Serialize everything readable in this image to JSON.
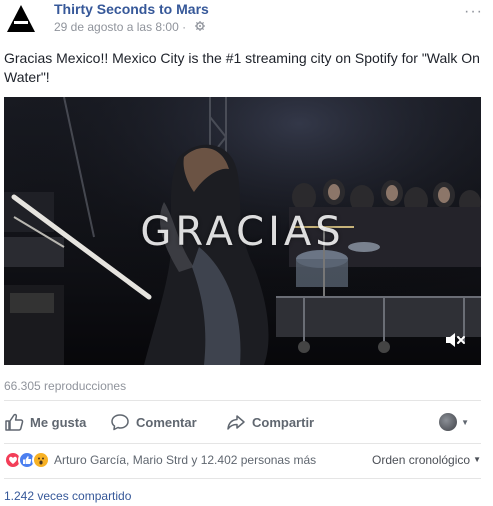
{
  "post": {
    "page_name": "Thirty Seconds to Mars",
    "timestamp": "29 de agosto a las 8:00",
    "separator": "·",
    "privacy_icon": "gear-globe-icon",
    "options_icon": "ellipsis-icon",
    "options_label": "···",
    "text": "Gracias Mexico!! Mexico City is the #1 streaming city on Spotify for \"Walk On Water\"!"
  },
  "video": {
    "overlay_text": "GRACIAS",
    "mute_icon": "speaker-muted-icon",
    "view_count": "66.305 reproducciones"
  },
  "actions": {
    "like_label": "Me gusta",
    "comment_label": "Comentar",
    "share_label": "Compartir"
  },
  "reactions": {
    "icons": [
      "love",
      "like",
      "wow"
    ],
    "summary": "Arturo García, Mario Strd y 12.402 personas más",
    "sort_label": "Orden cronológico"
  },
  "shares": {
    "label": "1.242 veces compartido"
  },
  "colors": {
    "link_blue": "#365899",
    "meta_gray": "#90949c",
    "action_gray": "#606770",
    "love_red": "#f33e58",
    "like_blue": "#4b7ff0",
    "wow_yellow": "#f7b125"
  }
}
